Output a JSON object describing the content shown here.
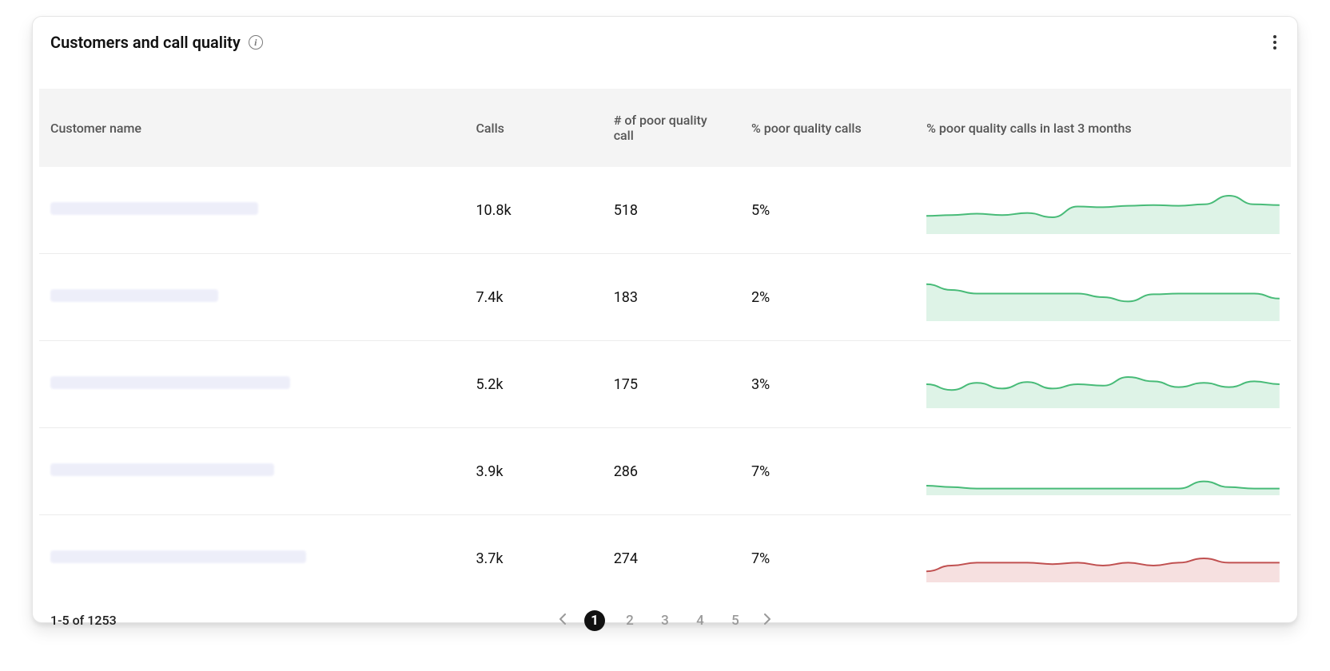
{
  "card": {
    "title": "Customers and call quality"
  },
  "table": {
    "columns": {
      "name": "Customer name",
      "calls": "Calls",
      "poor_count": "# of poor quality call",
      "poor_pct": "% poor quality calls",
      "spark": "% poor quality calls in last 3 months"
    },
    "rows": [
      {
        "calls": "10.8k",
        "poor_count": "518",
        "poor_pct": "5%",
        "spark_color": "green",
        "spark_values": [
          22,
          23,
          25,
          23,
          26,
          20,
          35,
          34,
          36,
          37,
          36,
          38,
          50,
          38,
          37
        ]
      },
      {
        "calls": "7.4k",
        "poor_count": "183",
        "poor_pct": "2%",
        "spark_color": "green",
        "spark_values": [
          48,
          40,
          35,
          35,
          35,
          35,
          35,
          30,
          24,
          34,
          35,
          35,
          35,
          35,
          28
        ]
      },
      {
        "calls": "5.2k",
        "poor_count": "175",
        "poor_pct": "3%",
        "spark_color": "green",
        "spark_values": [
          30,
          22,
          32,
          24,
          33,
          24,
          30,
          28,
          40,
          34,
          26,
          32,
          26,
          34,
          30
        ]
      },
      {
        "calls": "3.9k",
        "poor_count": "286",
        "poor_pct": "7%",
        "spark_color": "green",
        "spark_values": [
          10,
          8,
          6,
          6,
          6,
          6,
          6,
          6,
          6,
          6,
          6,
          16,
          8,
          6,
          6
        ]
      },
      {
        "calls": "3.7k",
        "poor_count": "274",
        "poor_pct": "7%",
        "spark_color": "red",
        "spark_values": [
          12,
          20,
          24,
          24,
          24,
          22,
          24,
          20,
          24,
          20,
          24,
          30,
          24,
          24,
          24
        ]
      }
    ]
  },
  "pagination": {
    "range_label": "1-5 of 1253",
    "pages": [
      "1",
      "2",
      "3",
      "4",
      "5"
    ],
    "current": "1"
  },
  "chart_data": {
    "type": "table",
    "title": "Customers and call quality",
    "columns": [
      "Customer name",
      "Calls",
      "# of poor quality call",
      "% poor quality calls"
    ],
    "rows": [
      [
        null,
        "10.8k",
        518,
        "5%"
      ],
      [
        null,
        "7.4k",
        183,
        "2%"
      ],
      [
        null,
        "5.2k",
        175,
        "3%"
      ],
      [
        null,
        "3.9k",
        286,
        "7%"
      ],
      [
        null,
        "3.7k",
        274,
        "7%"
      ]
    ],
    "sparklines": {
      "label": "% poor quality calls in last 3 months",
      "series": [
        {
          "color": "green",
          "values": [
            22,
            23,
            25,
            23,
            26,
            20,
            35,
            34,
            36,
            37,
            36,
            38,
            50,
            38,
            37
          ]
        },
        {
          "color": "green",
          "values": [
            48,
            40,
            35,
            35,
            35,
            35,
            35,
            30,
            24,
            34,
            35,
            35,
            35,
            35,
            28
          ]
        },
        {
          "color": "green",
          "values": [
            30,
            22,
            32,
            24,
            33,
            24,
            30,
            28,
            40,
            34,
            26,
            32,
            26,
            34,
            30
          ]
        },
        {
          "color": "green",
          "values": [
            10,
            8,
            6,
            6,
            6,
            6,
            6,
            6,
            6,
            6,
            6,
            16,
            8,
            6,
            6
          ]
        },
        {
          "color": "red",
          "values": [
            12,
            20,
            24,
            24,
            24,
            22,
            24,
            20,
            24,
            20,
            24,
            30,
            24,
            24,
            24
          ]
        }
      ]
    }
  }
}
